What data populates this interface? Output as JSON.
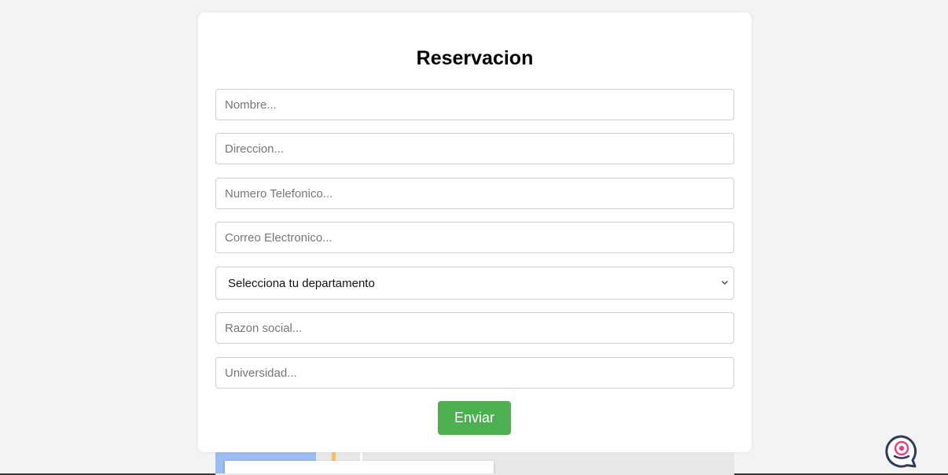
{
  "form": {
    "title": "Reservacion",
    "fields": [
      {
        "name": "nombre",
        "placeholder": "Nombre...",
        "value": ""
      },
      {
        "name": "direccion",
        "placeholder": "Direccion...",
        "value": ""
      },
      {
        "name": "telefono",
        "placeholder": "Numero Telefonico...",
        "value": ""
      },
      {
        "name": "correo",
        "placeholder": "Correo Electronico...",
        "value": ""
      },
      {
        "name": "razon-social",
        "placeholder": "Razon social...",
        "value": ""
      },
      {
        "name": "universidad",
        "placeholder": "Universidad...",
        "value": ""
      }
    ],
    "department_select": {
      "selected": "Selecciona tu departamento",
      "icon": "chevron-down-icon"
    },
    "submit_label": "Enviar"
  },
  "chat_widget": {
    "icon": "chat-bubble-icon"
  },
  "colors": {
    "page_background": "#f3f3f3",
    "card_background": "#ffffff",
    "accent_button": "#4caf50",
    "chat_outline": "#2f3a5a",
    "chat_dot": "#e0457b"
  }
}
